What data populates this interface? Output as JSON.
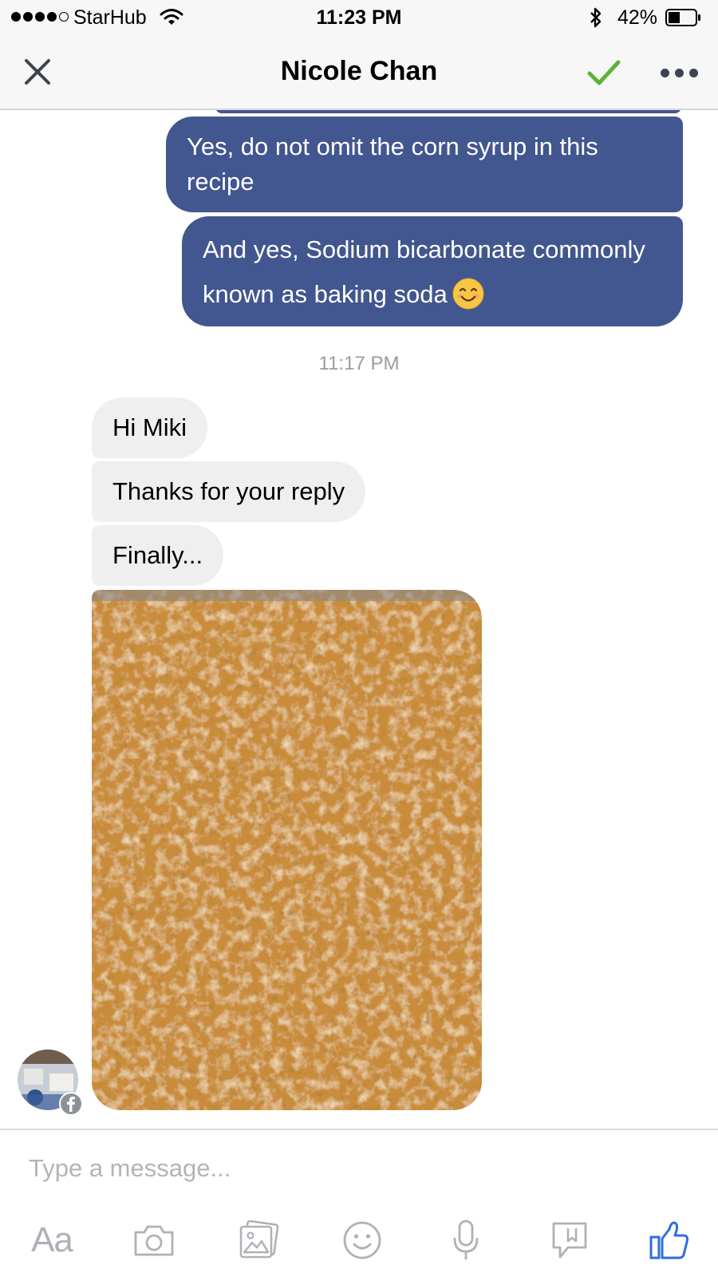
{
  "status_bar": {
    "carrier": "StarHub",
    "time": "11:23 PM",
    "battery": "42%",
    "battery_level": 0.42,
    "signal_bars": 4,
    "icons": [
      "wifi-icon",
      "bluetooth-icon",
      "battery-icon"
    ]
  },
  "header": {
    "title": "Nicole Chan",
    "icons": [
      "close-icon",
      "check-icon",
      "more-icon"
    ]
  },
  "messages": {
    "outgoing": [
      {
        "text": "Yes, do not omit the corn syrup in this recipe"
      },
      {
        "text": "And yes, Sodium bicarbonate commonly known as baking soda",
        "emoji": "smiling-face-icon"
      }
    ],
    "timestamp": "11:17 PM",
    "incoming": [
      {
        "text": "Hi Miki"
      },
      {
        "text": "Thanks for your reply"
      },
      {
        "text": "Finally..."
      }
    ],
    "photo": "caramel-popcorn-photo"
  },
  "composer": {
    "placeholder": "Type a message...",
    "text_style_label": "Aa",
    "tools": [
      "text-style-button",
      "camera-icon",
      "gallery-icon",
      "emoji-icon",
      "microphone-icon",
      "location-icon",
      "like-icon"
    ]
  },
  "colors": {
    "outgoing_bubble": "#42568f",
    "incoming_bubble": "#efefef",
    "accent_blue": "#2f6ee0",
    "check_green": "#5bb336",
    "toolbar_gray": "#aeb1b6"
  }
}
